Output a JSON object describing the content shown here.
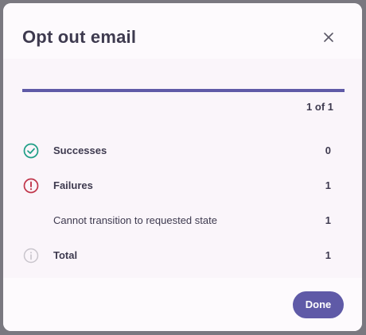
{
  "dialog": {
    "title": "Opt out email",
    "close_icon": "close-icon"
  },
  "progress": {
    "percent": 100,
    "count_text": "1 of 1",
    "bar_color": "#5f5aa7"
  },
  "results": [
    {
      "icon": "check-circle-icon",
      "icon_color": "#1e9e86",
      "label": "Successes",
      "value": "0"
    },
    {
      "icon": "error-circle-icon",
      "icon_color": "#c0354a",
      "label": "Failures",
      "value": "1"
    },
    {
      "icon": null,
      "label": "Cannot transition to requested state",
      "value": "1"
    },
    {
      "icon": "info-circle-icon",
      "icon_color": "#c9c5cc",
      "label": "Total",
      "value": "1"
    }
  ],
  "footer": {
    "done_label": "Done",
    "accent_color": "#5f5aa7"
  }
}
